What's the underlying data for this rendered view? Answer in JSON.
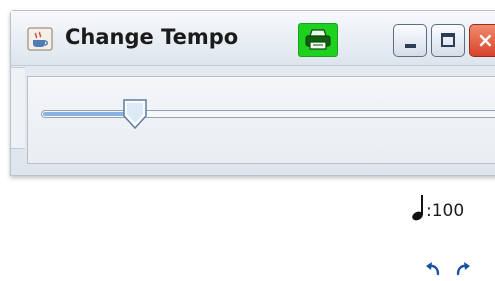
{
  "window": {
    "title": "Change Tempo"
  },
  "slider": {
    "value_fraction": 0.2
  },
  "tempo": {
    "value_text": ":100"
  },
  "colors": {
    "print_button": "#1fd11f",
    "slider_fill": "#8bb2de",
    "close_button": "#d8422a"
  },
  "icons": {
    "app": "java-cup-icon",
    "print": "printer-icon",
    "note": "quarter-note-icon",
    "undo": "undo-icon",
    "redo": "redo-icon"
  }
}
